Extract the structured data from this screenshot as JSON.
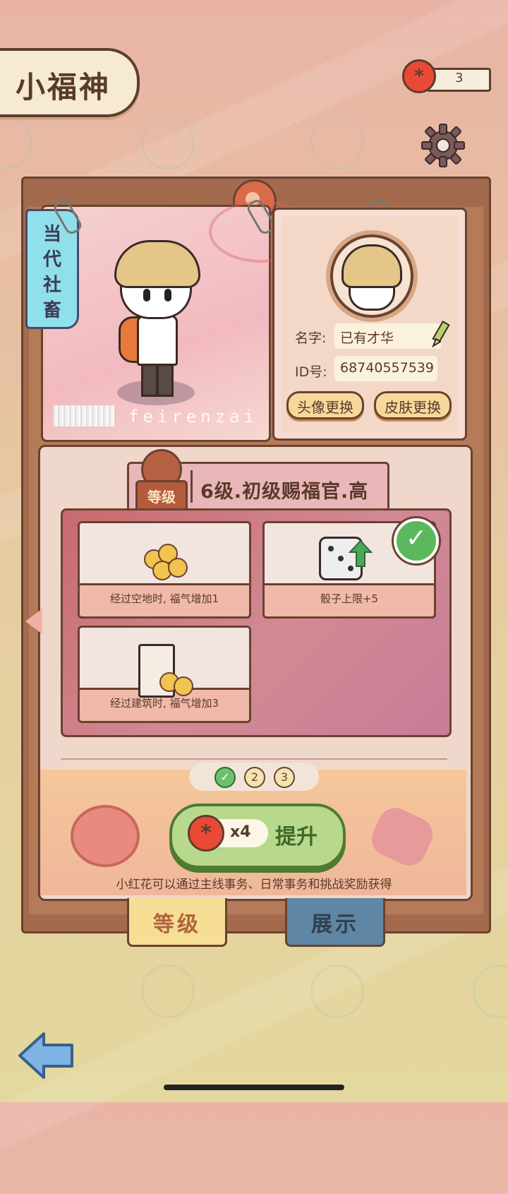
{
  "header": {
    "title": "小福神",
    "flower_count": "3",
    "settings_icon": "gear-icon"
  },
  "profile": {
    "job_tag_chars": [
      "当",
      "代",
      "社",
      "畜"
    ],
    "brand_text": "feirenzai",
    "name_label": "名字:",
    "name_value": "已有才华",
    "id_label": "ID号:",
    "id_value": "68740557539",
    "avatar_button": "头像更换",
    "skin_button": "皮肤更换"
  },
  "level": {
    "badge": "等级",
    "name": "6级.初级赐福官.高",
    "perks": [
      {
        "label": "经过空地时, 福气增加1",
        "icon": "coin-pile-icon",
        "achieved": false
      },
      {
        "label": "骰子上限+5",
        "icon": "dice-up-icon",
        "achieved": true
      },
      {
        "label": "经过建筑时, 福气增加3",
        "icon": "building-coins-icon",
        "achieved": false
      }
    ],
    "steps": [
      {
        "label": "✓",
        "done": true
      },
      {
        "label": "2",
        "done": false
      },
      {
        "label": "3",
        "done": false
      }
    ],
    "upgrade_cost": "x4",
    "upgrade_label": "提升",
    "hint": "小红花可以通过主线事务、日常事务和挑战奖励获得"
  },
  "tabs": {
    "level": "等级",
    "show": "展示"
  },
  "colors": {
    "accent_red": "#e94a35",
    "upgrade_green": "#b8d98b",
    "board_brown": "#a36a4d"
  }
}
